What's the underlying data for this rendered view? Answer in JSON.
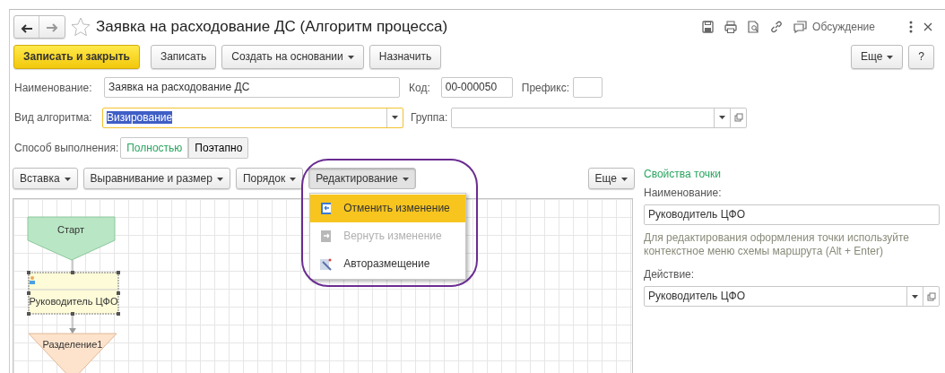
{
  "window": {
    "title": "Заявка на расходование ДС (Алгоритм процесса)",
    "favorite": false,
    "discussion": "Обсуждение"
  },
  "toolbar": {
    "buttons": [
      {
        "label": "Записать и закрыть",
        "kind": "primary"
      },
      {
        "label": "Записать",
        "kind": "plain"
      },
      {
        "label": "Создать на основании",
        "kind": "dropdown"
      },
      {
        "label": "Назначить",
        "kind": "plain"
      }
    ],
    "more": "Еще",
    "help": "?"
  },
  "form": {
    "name": {
      "label": "Наименование:",
      "value": "Заявка на расходование ДС"
    },
    "code": {
      "label": "Код:",
      "value": "00-000050"
    },
    "prefix": {
      "label": "Префикс:"
    },
    "algorithm": {
      "label": "Вид алгоритма:",
      "value": "Визирование",
      "focused": true,
      "text_selected": true
    },
    "group": {
      "label": "Группа:"
    },
    "mode": {
      "label": "Способ выполнения:",
      "options": [
        {
          "label": "Полностью",
          "selected": true
        },
        {
          "label": "Поэтапно",
          "selected": false
        }
      ]
    }
  },
  "editor_toolbar": {
    "buttons": [
      {
        "label": "Вставка",
        "pressed": false
      },
      {
        "label": "Выравнивание и размер",
        "pressed": false
      },
      {
        "label": "Порядок",
        "pressed": false
      },
      {
        "label": "Редактирование",
        "pressed": true
      }
    ],
    "more": "Еще"
  },
  "menu": {
    "highlighted": true,
    "items": [
      {
        "label": "Отменить изменение",
        "kind": "undo",
        "disabled": false,
        "selected": true
      },
      {
        "label": "Вернуть изменение",
        "kind": "redo",
        "disabled": true,
        "selected": false
      },
      {
        "label": "Авторазмещение",
        "kind": "auto",
        "disabled": false,
        "selected": false
      }
    ]
  },
  "diagram": {
    "nodes": [
      {
        "kind": "start",
        "label": "Старт"
      },
      {
        "kind": "action",
        "label": "Руководитель ЦФО",
        "selected": true
      },
      {
        "kind": "split",
        "label": "Разделение1"
      }
    ]
  },
  "properties": {
    "title": "Свойства точки",
    "name_label": "Наименование:",
    "name_value": "Руководитель ЦФО",
    "hint": "Для редактирования оформления точки используйте контекстное меню схемы маршрута (Alt + Enter)",
    "action_label": "Действие:",
    "action_value": "Руководитель ЦФО"
  }
}
